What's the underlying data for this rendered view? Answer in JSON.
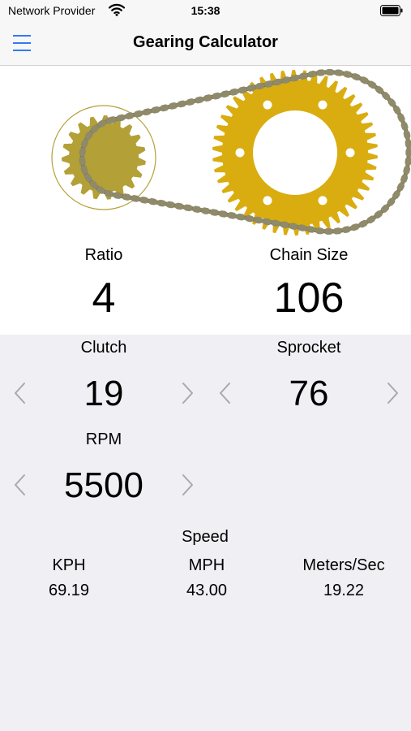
{
  "status": {
    "carrier": "Network Provider",
    "time": "15:38"
  },
  "nav": {
    "title": "Gearing Calculator"
  },
  "summary": {
    "ratio_label": "Ratio",
    "ratio_value": "4",
    "chain_label": "Chain Size",
    "chain_value": "106"
  },
  "clutch": {
    "label": "Clutch",
    "value": "19"
  },
  "sprocket": {
    "label": "Sprocket",
    "value": "76"
  },
  "rpm": {
    "label": "RPM",
    "value": "5500"
  },
  "speed": {
    "heading": "Speed",
    "kph_label": "KPH",
    "kph_value": "69.19",
    "mph_label": "MPH",
    "mph_value": "43.00",
    "mps_label": "Meters/Sec",
    "mps_value": "19.22"
  },
  "colors": {
    "accent": "#3478f6",
    "clutch_gear": "#b3a036",
    "sprocket_gear": "#d9ad10",
    "chain": "#6e6a52",
    "chevron": "#a8a8ad"
  },
  "icons": [
    "menu-icon",
    "wifi-icon",
    "battery-icon",
    "chevron-left-icon",
    "chevron-right-icon"
  ]
}
